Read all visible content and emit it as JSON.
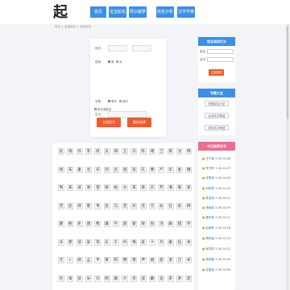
{
  "header": {
    "logo_char": "起",
    "nav": [
      "首页",
      "宝宝起名",
      "周公解梦",
      "姓名分析",
      "汉字字典"
    ]
  },
  "breadcrumb": "首页 > 宝宝起名 > 宝宝起名",
  "form": {
    "surname_label": "姓氏：",
    "surname_value": "",
    "gender_label": "性别：",
    "gender_options": [
      "男",
      "女"
    ],
    "namelen_label": "字数：",
    "namelen_options": [
      "单字",
      "双字"
    ],
    "birthday_label": "生日：",
    "birthday_value": "",
    "checkbox_label": "按生辰起名",
    "btn_left": "立即起名",
    "btn_right": "重新选择"
  },
  "side_analysis": {
    "title": "姓名测试打分",
    "surname_label": "姓氏：",
    "name_label": "名字：",
    "button": "立即测试"
  },
  "side_topics": {
    "title": "专题大全",
    "items": [
      "宝宝起名大全",
      "女孩名字精选",
      "男孩名字精选"
    ]
  },
  "side_names": {
    "title": "今日推荐名字",
    "items": [
      {
        "name": "王子涵",
        "date": "7-26 14:28"
      },
      {
        "name": "李子轩",
        "date": "7-26 14:27"
      },
      {
        "name": "张思雨",
        "date": "7-26 14:25"
      },
      {
        "name": "刘梓萱",
        "date": "7-26 14:22"
      },
      {
        "name": "陈浩然",
        "date": "7-26 14:21"
      },
      {
        "name": "杨雨泽",
        "date": "7-26 14:19"
      },
      {
        "name": "黄欣怡",
        "date": "7-26 14:17"
      },
      {
        "name": "赵雨轩",
        "date": "7-26 14:16"
      },
      {
        "name": "周梓涵",
        "date": "7-26 14:13"
      },
      {
        "name": "吴宇航",
        "date": "7-26 14:12"
      },
      {
        "name": "徐若曦",
        "date": "7-26 14:10"
      },
      {
        "name": "孙嘉怡",
        "date": "7-26 14:09"
      }
    ]
  },
  "surname_grid": [
    [
      "赵",
      "钱",
      "孙",
      "李",
      "周",
      "吴",
      "郑",
      "王",
      "冯",
      "陈",
      "褚",
      "卫",
      "蒋",
      "沈",
      "韩"
    ],
    [
      "杨",
      "朱",
      "秦",
      "尤",
      "许",
      "何",
      "吕",
      "施",
      "张",
      "孔",
      "曹",
      "严",
      "华",
      "金",
      "魏"
    ],
    [
      "陶",
      "姜",
      "戚",
      "谢",
      "邹",
      "喻",
      "柏",
      "水",
      "窦",
      "章",
      "云",
      "苏",
      "潘",
      "葛",
      "奚"
    ],
    [
      "范",
      "彭",
      "郎",
      "鲁",
      "韦",
      "昌",
      "马",
      "苗",
      "凤",
      "花",
      "方",
      "俞",
      "任",
      "袁",
      "柳"
    ],
    [
      "酆",
      "鲍",
      "史",
      "唐",
      "费",
      "廉",
      "岑",
      "薛",
      "雷",
      "贺",
      "倪",
      "汤",
      "滕",
      "殷",
      "罗"
    ],
    [
      "毕",
      "郝",
      "邬",
      "安",
      "常",
      "乐",
      "于",
      "时",
      "傅",
      "皮",
      "卞",
      "齐",
      "康",
      "伍",
      "余"
    ],
    [
      "元",
      "卜",
      "顾",
      "孟",
      "平",
      "黄",
      "和",
      "穆",
      "萧",
      "尹",
      "姚",
      "邵",
      "湛",
      "汪",
      "祁"
    ],
    [
      "毛",
      "禹",
      "狄",
      "米",
      "贝",
      "明",
      "臧",
      "计",
      "伏",
      "成",
      "戴",
      "谈",
      "宋",
      "茅",
      "庞"
    ]
  ],
  "colors": {
    "nav_blue": "#3b8fe6",
    "button_orange": "#f25a2a",
    "side_pink": "#ee6b93"
  }
}
